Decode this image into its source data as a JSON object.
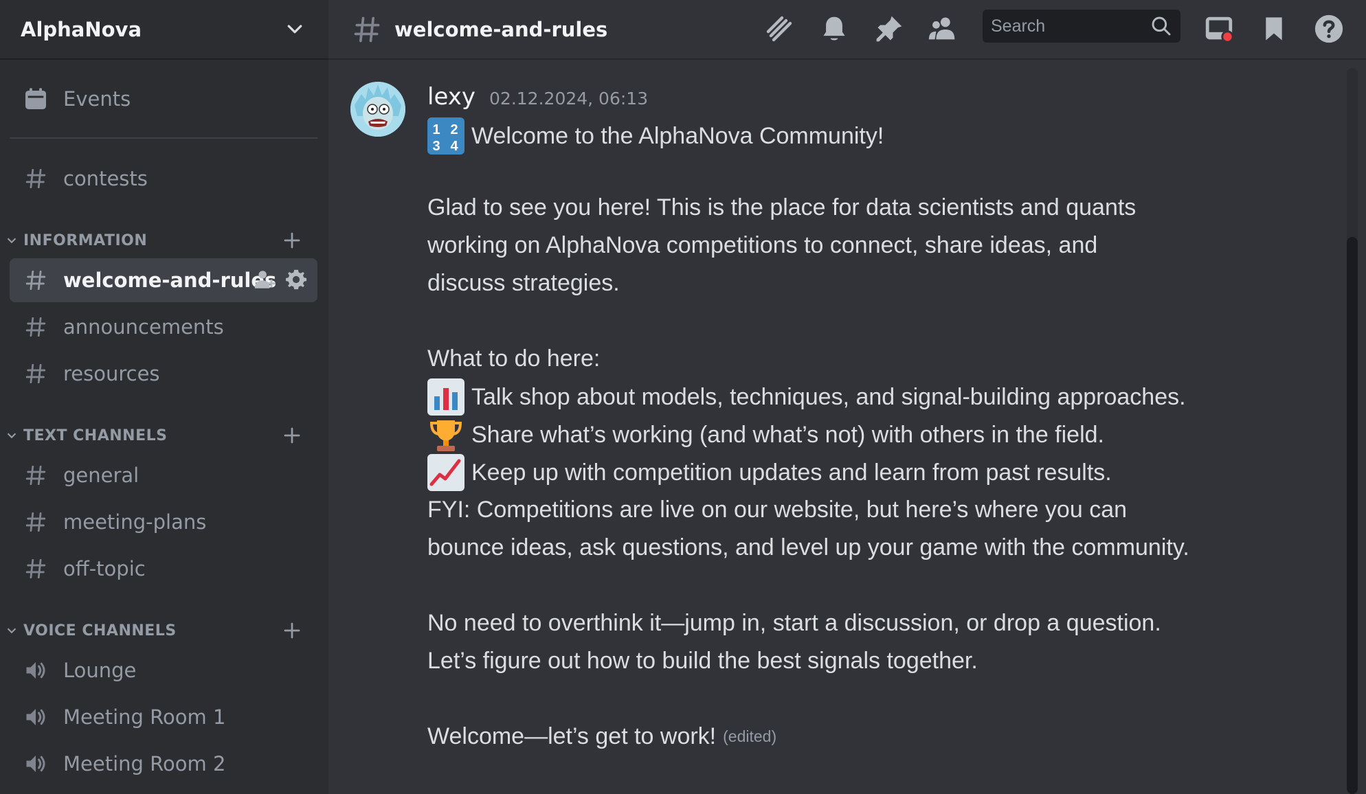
{
  "server": {
    "name": "AlphaNova"
  },
  "sidebar": {
    "events_label": "Events",
    "top_channels": [
      {
        "label": "contests"
      }
    ],
    "categories": [
      {
        "label": "INFORMATION",
        "channels": [
          {
            "label": "welcome-and-rules",
            "active": true
          },
          {
            "label": "announcements"
          },
          {
            "label": "resources"
          }
        ]
      },
      {
        "label": "TEXT CHANNELS",
        "channels": [
          {
            "label": "general"
          },
          {
            "label": "meeting-plans"
          },
          {
            "label": "off-topic"
          }
        ]
      },
      {
        "label": "VOICE CHANNELS",
        "channels": [
          {
            "label": "Lounge"
          },
          {
            "label": "Meeting Room 1"
          },
          {
            "label": "Meeting Room 2"
          }
        ]
      }
    ]
  },
  "header": {
    "channel_name": "welcome-and-rules",
    "search_placeholder": "Search",
    "icons": [
      "threads-icon",
      "bell-icon",
      "pin-icon",
      "members-icon",
      "search-icon",
      "inbox-icon",
      "bookmark-icon",
      "help-icon"
    ]
  },
  "message": {
    "author": "lexy",
    "timestamp": "02.12.2024, 06:13",
    "lines": [
      "Welcome to the AlphaNova Community!",
      "Glad to see you here! This is the place for data scientists and quants",
      "working on AlphaNova competitions to connect, share ideas, and",
      "discuss strategies.",
      "What to do here:",
      "Talk shop about models, techniques, and signal-building approaches.",
      "Share what’s working (and what’s not) with others in the field.",
      "Keep up with competition updates and learn from past results.",
      "FYI: Competitions are live on our website, but here’s where you can",
      "bounce ideas, ask questions, and level up your game with the community.",
      "No need to overthink it—jump in, start a discussion, or drop a question.",
      "Let’s figure out how to build the best signals together.",
      "Welcome—let’s get to work!"
    ],
    "edited_label": "(edited)",
    "emojis": [
      "numbers-emoji",
      "bar-chart-emoji",
      "trophy-emoji",
      "chart-increasing-emoji"
    ]
  },
  "colors": {
    "background": "#313338",
    "sidebar": "#2b2d31",
    "active_item": "#404249",
    "muted": "#949ba4",
    "text": "#dbdee1"
  }
}
